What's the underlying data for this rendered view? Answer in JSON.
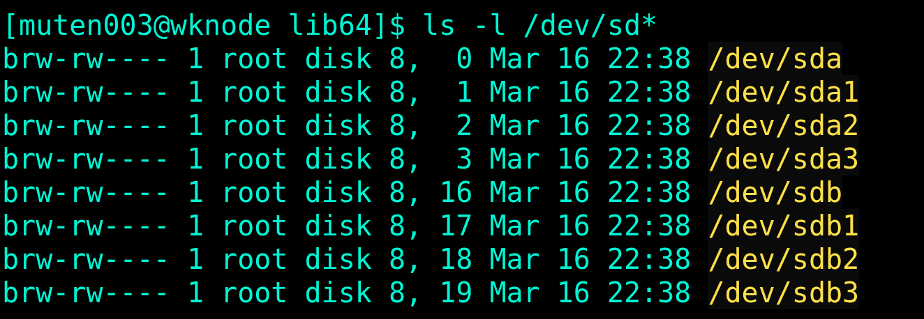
{
  "terminal": {
    "command_line": "[muten003@wknode lib64]$ ls -l /dev/sd*",
    "entries": [
      {
        "details": "brw-rw---- 1 root disk 8,  0 Mar 16 22:38",
        "name": "/dev/sda"
      },
      {
        "details": "brw-rw---- 1 root disk 8,  1 Mar 16 22:38",
        "name": "/dev/sda1"
      },
      {
        "details": "brw-rw---- 1 root disk 8,  2 Mar 16 22:38",
        "name": "/dev/sda2"
      },
      {
        "details": "brw-rw---- 1 root disk 8,  3 Mar 16 22:38",
        "name": "/dev/sda3"
      },
      {
        "details": "brw-rw---- 1 root disk 8, 16 Mar 16 22:38",
        "name": "/dev/sdb"
      },
      {
        "details": "brw-rw---- 1 root disk 8, 17 Mar 16 22:38",
        "name": "/dev/sdb1"
      },
      {
        "details": "brw-rw---- 1 root disk 8, 18 Mar 16 22:38",
        "name": "/dev/sdb2"
      },
      {
        "details": "brw-rw---- 1 root disk 8, 19 Mar 16 22:38",
        "name": "/dev/sdb3"
      }
    ]
  }
}
